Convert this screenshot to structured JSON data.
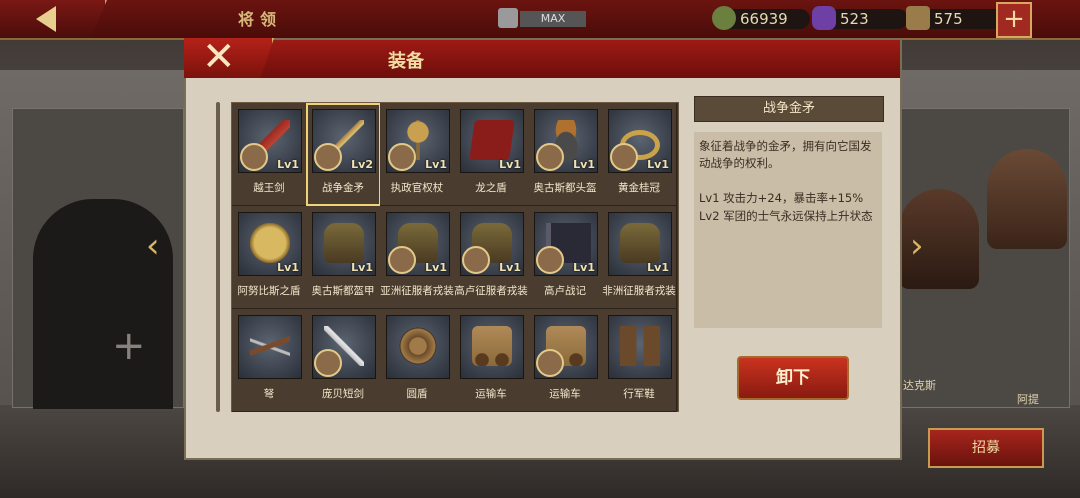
{
  "topbar": {
    "title": "将领",
    "max_label": "MAX",
    "plus_label": "+"
  },
  "resources": [
    {
      "name": "gold",
      "value": "66939",
      "color": "#6b7f3e"
    },
    {
      "name": "gem",
      "value": "523",
      "color": "#6e3fa4"
    },
    {
      "name": "troops",
      "value": "575",
      "color": "#9a7b4a"
    }
  ],
  "modal": {
    "title": "装备",
    "close_label": "✕"
  },
  "items": [
    {
      "name": "越王剑",
      "level": "Lv1",
      "has_owner": true,
      "icon": "sword-icon"
    },
    {
      "name": "战争金矛",
      "level": "Lv2",
      "has_owner": true,
      "icon": "spear-icon",
      "selected": true
    },
    {
      "name": "执政官权杖",
      "level": "Lv1",
      "has_owner": true,
      "icon": "scepter-icon"
    },
    {
      "name": "龙之盾",
      "level": "Lv1",
      "has_owner": false,
      "icon": "banner-shield-icon"
    },
    {
      "name": "奥古斯都头盔",
      "level": "Lv1",
      "has_owner": true,
      "icon": "helmet-icon"
    },
    {
      "name": "黄金桂冠",
      "level": "Lv1",
      "has_owner": true,
      "icon": "laurel-crown-icon"
    },
    {
      "name": "阿努比斯之盾",
      "level": "Lv1",
      "has_owner": false,
      "icon": "oval-shield-icon"
    },
    {
      "name": "奥古斯都盔甲",
      "level": "Lv1",
      "has_owner": false,
      "icon": "armor-icon"
    },
    {
      "name": "亚洲征服者戎装",
      "level": "Lv1",
      "has_owner": true,
      "icon": "armor-icon"
    },
    {
      "name": "高卢征服者戎装",
      "level": "Lv1",
      "has_owner": true,
      "icon": "armor-icon"
    },
    {
      "name": "高卢战记",
      "level": "Lv1",
      "has_owner": true,
      "icon": "book-icon"
    },
    {
      "name": "非洲征服者戎装",
      "level": "Lv1",
      "has_owner": false,
      "icon": "armor-icon"
    },
    {
      "name": "弩",
      "level": "",
      "has_owner": false,
      "icon": "crossbow-icon"
    },
    {
      "name": "庞贝短剑",
      "level": "",
      "has_owner": true,
      "icon": "short-sword-icon"
    },
    {
      "name": "圆盾",
      "level": "",
      "has_owner": false,
      "icon": "round-shield-icon"
    },
    {
      "name": "运输车",
      "level": "",
      "has_owner": false,
      "icon": "cart-icon"
    },
    {
      "name": "运输车",
      "level": "",
      "has_owner": true,
      "icon": "cart-icon"
    },
    {
      "name": "行军鞋",
      "level": "",
      "has_owner": false,
      "icon": "boots-icon"
    }
  ],
  "detail": {
    "title": "战争金矛",
    "description": "象征着战争的金矛，拥有向它国发动战争的权利。",
    "effects": [
      "Lv1  攻击力+24，暴击率+15%",
      "Lv2  军团的士气永远保持上升状态"
    ]
  },
  "unequip_label": "卸下",
  "recruit_label": "招募",
  "side": {
    "left_plus": "+",
    "hero_name_1": "达克斯",
    "hero_name_2": "阿提"
  }
}
